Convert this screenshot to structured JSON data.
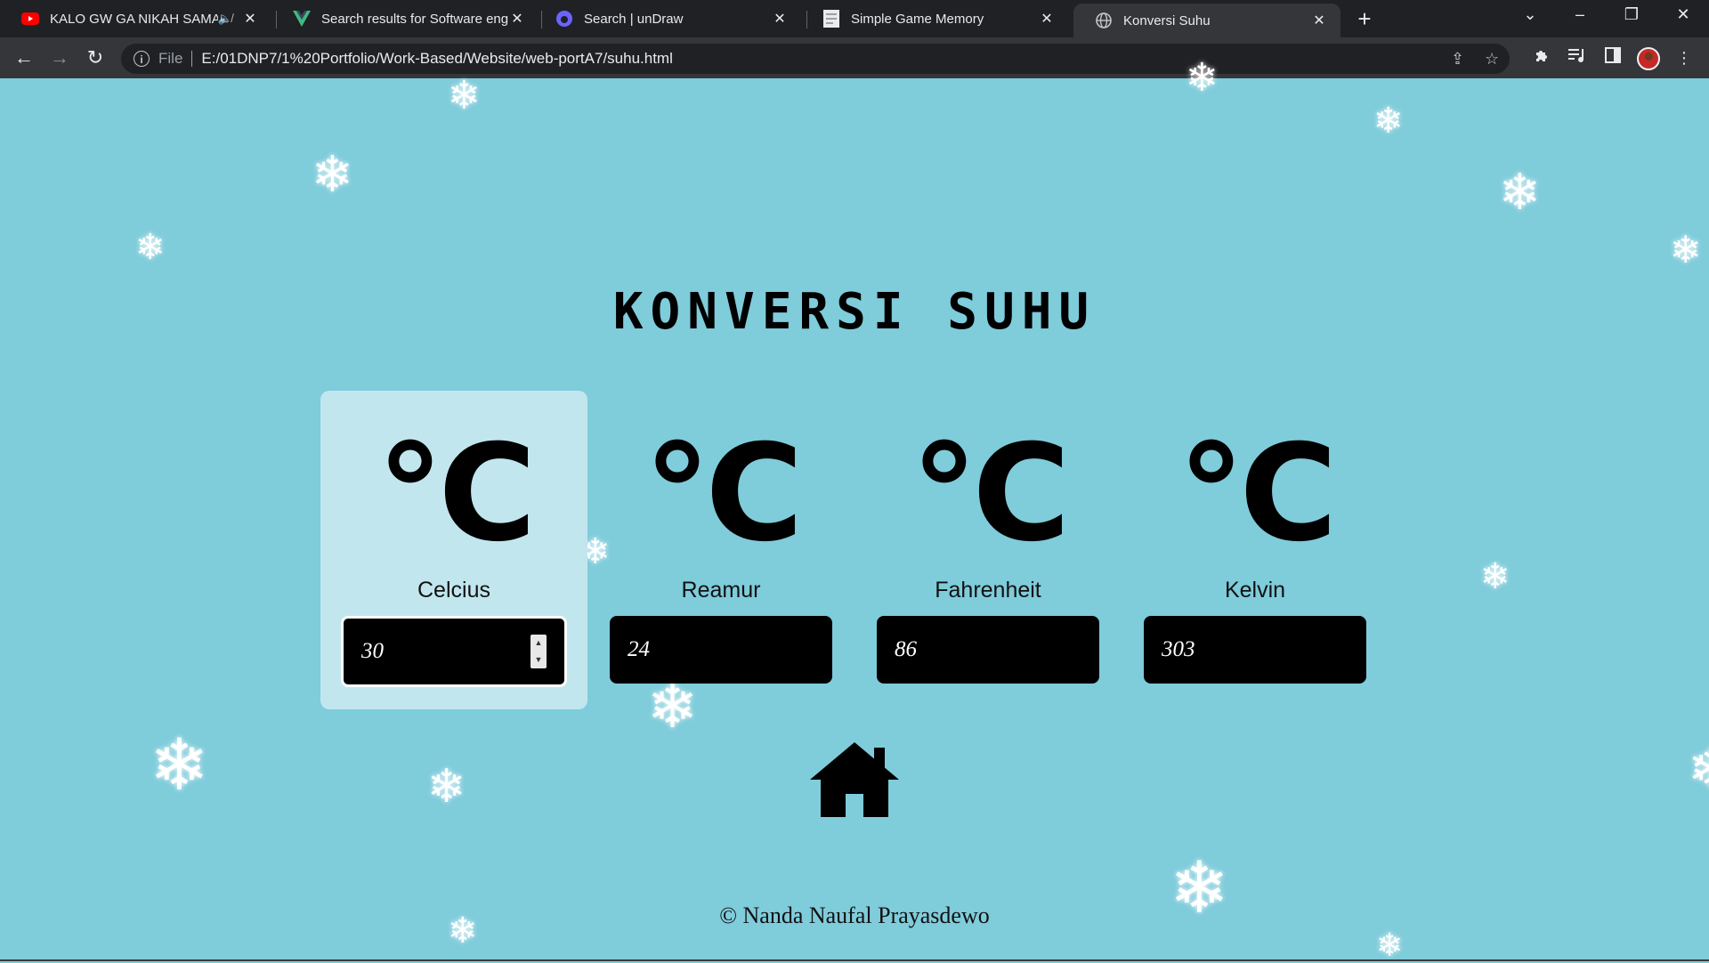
{
  "browser": {
    "tabs": [
      {
        "title": "KALO GW GA NIKAH SAMA D",
        "favicon": "youtube-icon",
        "muted": true
      },
      {
        "title": "Search results for Software engin",
        "favicon": "vue-icon"
      },
      {
        "title": "Search | unDraw",
        "favicon": "undraw-icon"
      },
      {
        "title": "Simple Game Memory",
        "favicon": "page-icon"
      },
      {
        "title": "Konversi Suhu",
        "favicon": "globe-icon",
        "active": true
      }
    ],
    "address": {
      "scheme": "File",
      "url": "E:/01DNP7/1%20Portfolio/Work-Based/Website/web-portA7/suhu.html"
    }
  },
  "page": {
    "title": "KONVERSI SUHU",
    "unit_symbol": "°C",
    "cards": [
      {
        "label": "Celcius",
        "value": "30",
        "active": true
      },
      {
        "label": "Reamur",
        "value": "24"
      },
      {
        "label": "Fahrenheit",
        "value": "86"
      },
      {
        "label": "Kelvin",
        "value": "303"
      }
    ],
    "footer": "© Nanda Naufal Prayasdewo"
  },
  "colors": {
    "background": "#7fccdb",
    "active_card": "#c2e6ee",
    "input_bg": "#000000"
  }
}
